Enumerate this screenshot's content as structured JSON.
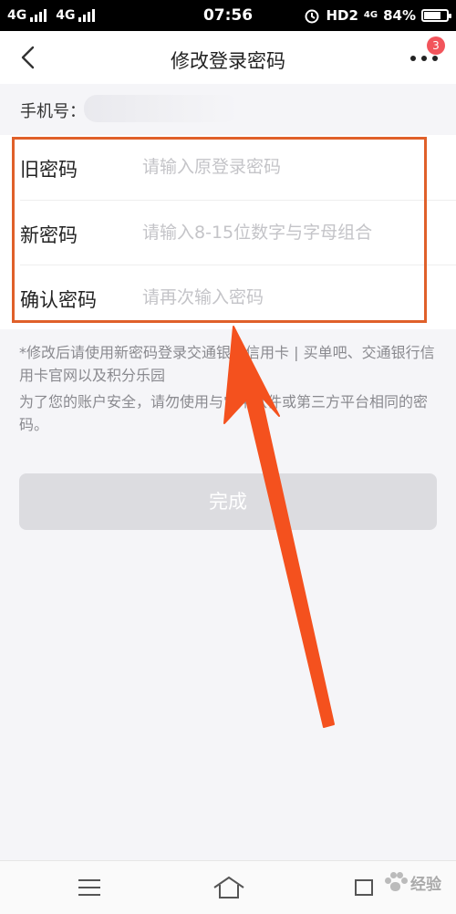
{
  "statusbar": {
    "network_1": "4G",
    "network_2": "4G",
    "time": "07:56",
    "hd": "HD2",
    "network_3": "4G",
    "battery": "84%",
    "battery_level": 0.84
  },
  "header": {
    "title": "修改登录密码",
    "badge_count": "3"
  },
  "account": {
    "phone_label": "手机号："
  },
  "form": {
    "fields": [
      {
        "label": "旧密码",
        "placeholder": "请输入原登录密码",
        "value": ""
      },
      {
        "label": "新密码",
        "placeholder": "请输入8-15位数字与字母组合",
        "value": ""
      },
      {
        "label": "确认密码",
        "placeholder": "请再次输入密码",
        "value": ""
      }
    ]
  },
  "notes": {
    "line1": "*修改后请使用新密码登录交通银行信用卡 | 买单吧、交通银行信用卡官网以及积分乐园",
    "line2": "为了您的账户安全，请勿使用与常用软件或第三方平台相同的密码。"
  },
  "actions": {
    "submit_label": "完成"
  },
  "watermark": {
    "text": "经验"
  },
  "colors": {
    "highlight": "#e0602a",
    "arrow": "#f4511e",
    "badge": "#f2545b",
    "button_disabled": "#dcdce0"
  }
}
